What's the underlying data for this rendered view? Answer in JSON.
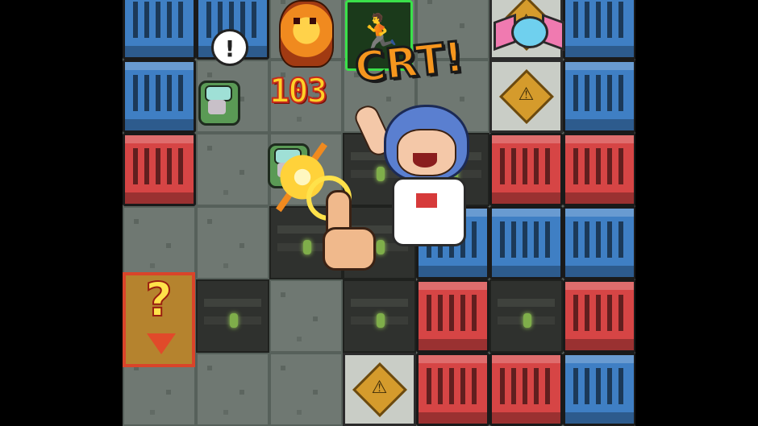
{
  "game": {
    "damage_number": "103",
    "crit_text": "CRT!",
    "alert_mark": "!",
    "mystery_mark": "?",
    "exit_glyph": "🏃",
    "hazard_glyph": "⚠"
  },
  "board": {
    "columns": 7,
    "rows": 6,
    "cells": [
      [
        "crate-blue",
        "crate-blue",
        "floor",
        "floor",
        "floor",
        "sign",
        "crate-blue"
      ],
      [
        "crate-blue",
        "floor",
        "floor",
        "floor",
        "floor",
        "sign",
        "crate-blue"
      ],
      [
        "crate-red",
        "floor",
        "floor",
        "pit",
        "pit",
        "crate-red",
        "crate-red"
      ],
      [
        "floor",
        "floor",
        "pit",
        "pit",
        "crate-blue",
        "crate-blue",
        "crate-blue"
      ],
      [
        "floor",
        "pit",
        "floor",
        "pit",
        "crate-red",
        "pit",
        "crate-red"
      ],
      [
        "floor",
        "floor",
        "floor",
        "sign",
        "crate-red",
        "crate-red",
        "crate-blue"
      ]
    ]
  },
  "colors": {
    "crate_blue": "#3f7fc4",
    "crate_red": "#d64545",
    "floor": "#6f7872",
    "pit": "#2f312e",
    "damage": "#ffd027",
    "crit": "#f6961e",
    "exit": "#3ae04a"
  },
  "icons": [
    "alert-bubble-icon",
    "robot-enemy-icon",
    "fire-monster-icon",
    "exit-sign-icon",
    "candy-icon",
    "hazard-sign-icon",
    "mystery-box-icon",
    "tap-hand-icon",
    "impact-burst-icon",
    "girl-hero-icon"
  ]
}
